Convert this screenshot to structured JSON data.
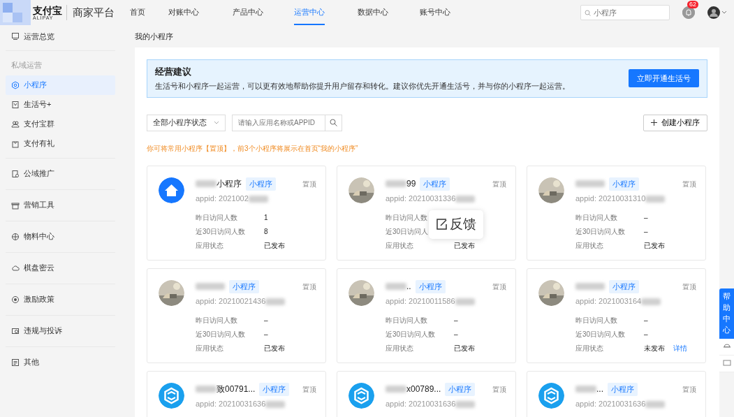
{
  "header": {
    "logo_text": "支付宝",
    "logo_sub": "ALIPAY",
    "platform": "商家平台",
    "nav": [
      {
        "label": "首页",
        "selected": false
      },
      {
        "label": "对账中心",
        "selected": false
      },
      {
        "label": "产品中心",
        "selected": false
      },
      {
        "label": "运营中心",
        "selected": true
      },
      {
        "label": "数据中心",
        "selected": false
      },
      {
        "label": "账号中心",
        "selected": false
      }
    ],
    "search": {
      "placeholder": "小程序"
    },
    "notification_count": "62"
  },
  "sidebar": {
    "groups": [
      {
        "items": [
          {
            "label": "运营总览",
            "selected": false
          }
        ]
      },
      {
        "heading": "私域运营",
        "items": [
          {
            "label": "小程序",
            "selected": true
          },
          {
            "label": "生活号+",
            "selected": false
          },
          {
            "label": "支付宝群",
            "selected": false
          },
          {
            "label": "支付有礼",
            "selected": false
          }
        ]
      },
      {
        "items": [
          {
            "label": "公域推广",
            "selected": false
          }
        ]
      },
      {
        "items": [
          {
            "label": "营销工具",
            "selected": false
          }
        ]
      },
      {
        "items": [
          {
            "label": "物料中心",
            "selected": false
          }
        ]
      },
      {
        "items": [
          {
            "label": "棋盘密云",
            "selected": false
          }
        ]
      },
      {
        "items": [
          {
            "label": "激励政策",
            "selected": false
          }
        ]
      },
      {
        "items": [
          {
            "label": "违规与投诉",
            "selected": false
          }
        ]
      },
      {
        "items": [
          {
            "label": "其他",
            "selected": false
          }
        ]
      }
    ]
  },
  "page_title": "我的小程序",
  "advice": {
    "title": "经营建议",
    "text": "生活号和小程序一起运营，可以更有效地帮助你提升用户留存和转化。建议你优先开通生活号，并与你的小程序一起运营。",
    "button": "立即开通生活号"
  },
  "filters": {
    "status_select": "全部小程序状态",
    "search_placeholder": "请输入应用名称或APPID",
    "create_button": "创建小程序"
  },
  "tip": "你可将常用小程序【置顶】，前3个小程序将展示在首页“我的小程序”",
  "cards": [
    {
      "kind": "logo",
      "name": "小程序",
      "badge": "小程序",
      "pin": "置顶",
      "appid": "appid: 2021002",
      "stats": [
        {
          "label": "昨日访问人数",
          "value": "1"
        },
        {
          "label": "近30日访问人数",
          "value": "8"
        },
        {
          "label": "应用状态",
          "value": "已发布"
        }
      ]
    },
    {
      "kind": "picture",
      "name": "99",
      "badge": "小程序",
      "pin": "置顶",
      "appid": "appid: 20210031336",
      "stats": [
        {
          "label": "昨日访问人数"
        },
        {
          "label": "近30日访问人"
        },
        {
          "label": "应用状态",
          "value": "已发布"
        }
      ]
    },
    {
      "kind": "picture",
      "badge": "小程序",
      "pin": "置顶",
      "appid": "appid: 20210031310",
      "stats": [
        {
          "label": "昨日访问人数",
          "value": "–"
        },
        {
          "label": "近30日访问人数",
          "value": "–"
        },
        {
          "label": "应用状态",
          "value": "已发布"
        }
      ]
    },
    {
      "kind": "picture",
      "badge": "小程序",
      "pin": "置顶",
      "appid": "appid: 20210021436",
      "stats": [
        {
          "label": "昨日访问人数",
          "value": "–"
        },
        {
          "label": "近30日访问人数",
          "value": "–"
        },
        {
          "label": "应用状态",
          "value": "已发布"
        }
      ]
    },
    {
      "kind": "picture",
      "name": "..",
      "badge": "小程序",
      "pin": "置顶",
      "appid": "appid: 20210011586",
      "stats": [
        {
          "label": "昨日访问人数",
          "value": "–"
        },
        {
          "label": "近30日访问人数",
          "value": "–"
        },
        {
          "label": "应用状态",
          "value": "已发布"
        }
      ]
    },
    {
      "kind": "picture",
      "badge": "小程序",
      "pin": "置顶",
      "appid": "appid: 2021003164",
      "stats": [
        {
          "label": "昨日访问人数",
          "value": "–"
        },
        {
          "label": "近30日访问人数",
          "value": "–"
        },
        {
          "label": "应用状态",
          "value": "未发布",
          "link": "详情"
        }
      ]
    },
    {
      "kind": "hexlogo",
      "name": "致00791...",
      "badge": "小程序",
      "pin": "置顶",
      "appid": "appid: 20210031636"
    },
    {
      "kind": "hexlogo",
      "name": "x00789...",
      "badge": "小程序",
      "pin": "置顶",
      "appid": "appid: 20210031636"
    },
    {
      "kind": "hexlogo",
      "name": "...",
      "badge": "小程序",
      "pin": "置顶",
      "appid": "appid: 20210031636"
    }
  ],
  "feedback": {
    "label": "反馈"
  },
  "help": {
    "label": "帮助中心"
  }
}
